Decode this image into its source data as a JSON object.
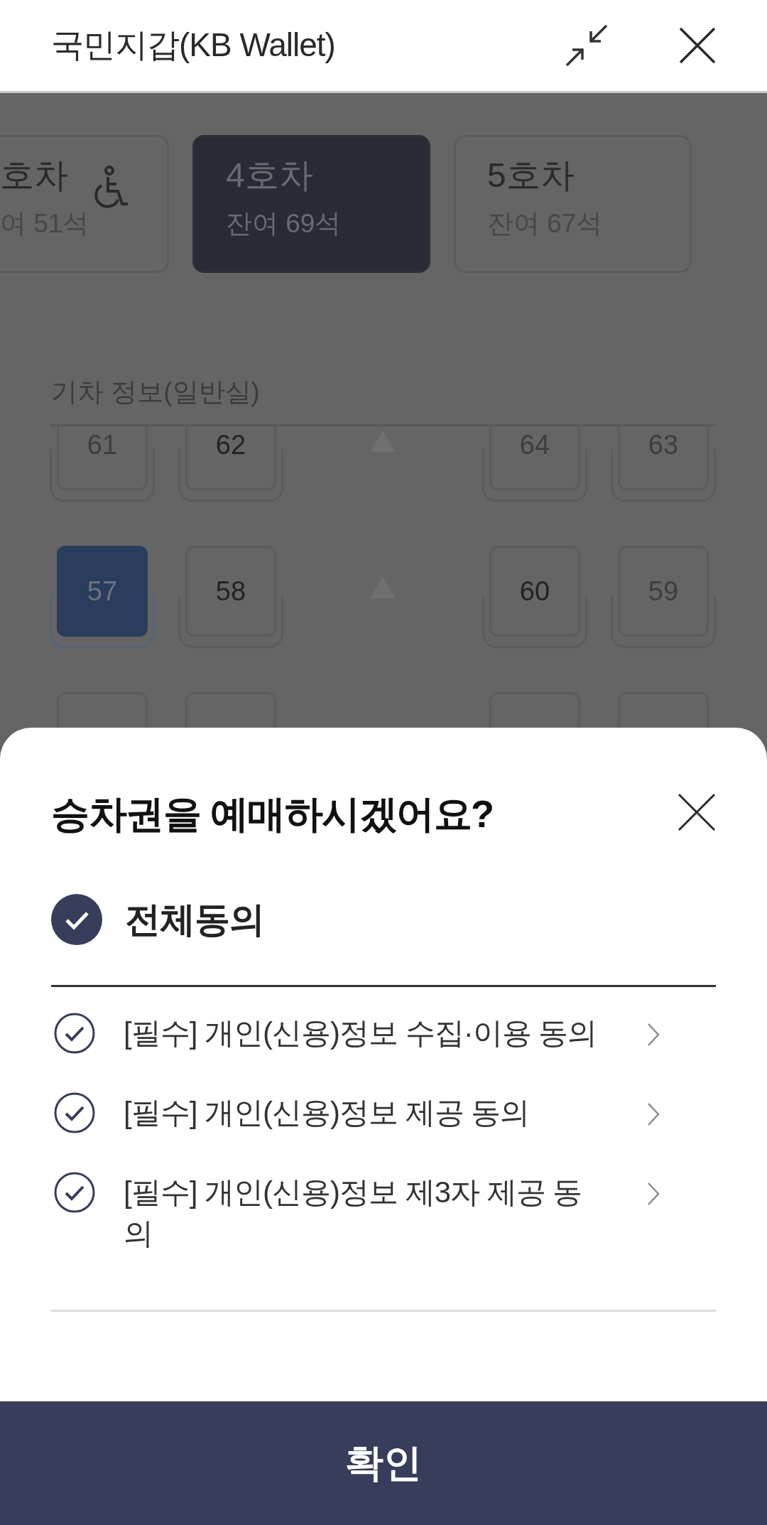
{
  "app_bar": {
    "title": "국민지갑(KB Wallet)"
  },
  "cars": [
    {
      "title": "호차",
      "remaining": "여 51석",
      "wheelchair": true,
      "selected": false
    },
    {
      "title": "4호차",
      "remaining": "잔여 69석",
      "wheelchair": false,
      "selected": true
    },
    {
      "title": "5호차",
      "remaining": "잔여 67석",
      "wheelchair": false,
      "selected": false
    }
  ],
  "seat_map": {
    "title": "기차 정보(일반실)",
    "rows": [
      {
        "seats": [
          {
            "number": "61",
            "available": false,
            "selected": false
          },
          {
            "number": "62",
            "available": true,
            "selected": false
          },
          {
            "number": "64",
            "available": false,
            "selected": false
          },
          {
            "number": "63",
            "available": false,
            "selected": false
          }
        ]
      },
      {
        "seats": [
          {
            "number": "57",
            "available": true,
            "selected": true
          },
          {
            "number": "58",
            "available": true,
            "selected": false
          },
          {
            "number": "60",
            "available": true,
            "selected": false
          },
          {
            "number": "59",
            "available": false,
            "selected": false
          }
        ]
      },
      {
        "seats": [
          {
            "selected": false
          },
          {
            "selected": false
          },
          {
            "selected": false
          },
          {
            "selected": false
          }
        ]
      }
    ]
  },
  "sheet": {
    "title": "승차권을 예매하시겠어요?",
    "agree_all": {
      "label": "전체동의",
      "checked": true
    },
    "terms": [
      {
        "label": "[필수] 개인(신용)정보 수집·이용 동의",
        "checked": true
      },
      {
        "label": "[필수] 개인(신용)정보 제공 동의",
        "checked": true
      },
      {
        "label": "[필수] 개인(신용)정보 제3자 제공 동의",
        "checked": true
      }
    ],
    "confirm_button": "확인"
  }
}
